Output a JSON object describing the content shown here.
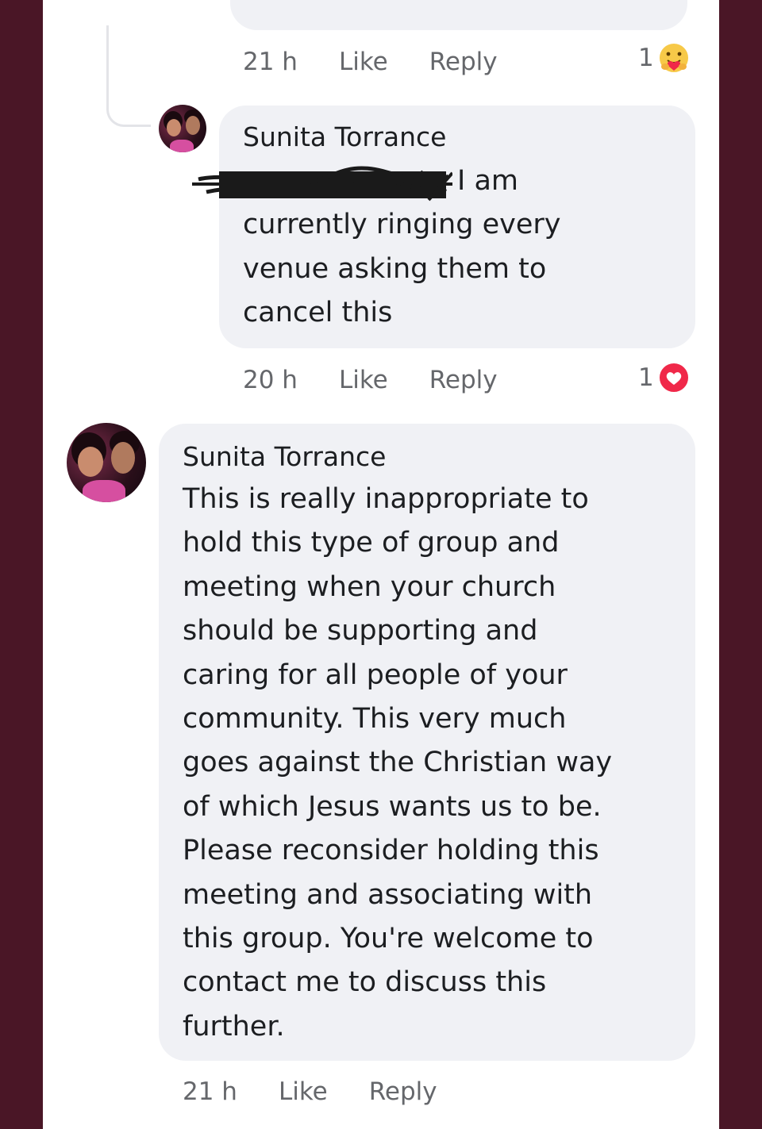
{
  "comments": [
    {
      "meta": {
        "time": "21 h",
        "like": "Like",
        "reply": "Reply"
      },
      "reaction": {
        "count": "1",
        "icon": "care-emoji-icon"
      }
    },
    {
      "author": "Sunita Torrance",
      "text_visible": "I am\ncurrently ringing every\nvenue asking them to\ncancel this",
      "meta": {
        "time": "20 h",
        "like": "Like",
        "reply": "Reply"
      },
      "reaction": {
        "count": "1",
        "icon": "love-heart-icon"
      }
    },
    {
      "author": "Sunita Torrance",
      "text": "This is really inappropriate to\nhold this type of group and\nmeeting  when your church\nshould be supporting and\ncaring for all people of your\ncommunity. This very much\ngoes against the Christian way\nof which Jesus wants us to be.\nPlease reconsider holding this\nmeeting and associating with\nthis group. You're welcome to\ncontact me to discuss this\nfurther.",
      "meta": {
        "time": "21 h",
        "like": "Like",
        "reply": "Reply"
      }
    }
  ],
  "colors": {
    "side_background": "#4a1626",
    "bubble": "#f0f1f5",
    "meta_text": "#65676b",
    "love_red": "#f02849",
    "care_yellow": "#f7c948"
  }
}
